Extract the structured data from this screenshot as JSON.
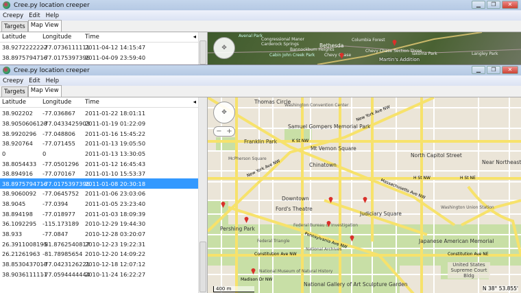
{
  "app_title": "Cree.py location creeper",
  "menu": [
    "Creepy",
    "Edit",
    "Help"
  ],
  "tabs": [
    "Targets",
    "Map View"
  ],
  "window_buttons": {
    "minimize": "▁",
    "restore": "❐",
    "close": "✕"
  },
  "columns": [
    "Latitude",
    "Longitude",
    "Time"
  ],
  "top_window": {
    "rows": [
      [
        "38.9272222222",
        "-77.0736111111",
        "2011-04-12 14:15:47"
      ],
      [
        "38.8975794716",
        "-77.0175397396",
        "2011-04-09 23:59:40"
      ]
    ],
    "map_labels": [
      "Avenal Park",
      "Congressional Manor",
      "Carderock Springs",
      "Cabin John Creek Park",
      "Bannockburn Heights",
      "Bethesda",
      "Columbia Forest",
      "Chevy Chase",
      "Chevy Chase Section Three",
      "Takoma Park",
      "Langley Park",
      "Martin's Addition"
    ]
  },
  "bottom_window": {
    "rows": [
      [
        "38.902202",
        "-77.036867",
        "2011-01-22 18:01:11"
      ],
      [
        "38.9050606128",
        "-77.0433425903",
        "2011-01-19 01:22:09"
      ],
      [
        "38.9920296",
        "-77.048806",
        "2011-01-16 15:45:22"
      ],
      [
        "38.920764",
        "-77.071455",
        "2011-01-13 19:05:50"
      ],
      [
        "0",
        "0",
        "2011-01-13 13:30:05"
      ],
      [
        "38.8054433",
        "-77.0501296",
        "2011-01-12 16:45:43"
      ],
      [
        "38.894916",
        "-77.070167",
        "2011-01-10 15:53:37"
      ],
      [
        "38.8975794716",
        "-77.0175397396",
        "2011-01-08 20:30:18"
      ],
      [
        "38.9060092",
        "-77.0645752",
        "2011-01-06 23:03:06"
      ],
      [
        "38.9045",
        "-77.0394",
        "2011-01-05 23:23:40"
      ],
      [
        "38.894198",
        "-77.018977",
        "2011-01-03 18:09:39"
      ],
      [
        "36.1092295",
        "-115.173189",
        "2010-12-29 19:44:30"
      ],
      [
        "38.933",
        "-77.0847",
        "2010-12-28 03:20:07"
      ],
      [
        "26.3911008195",
        "-81.8762540817",
        "2010-12-23 19:22:31"
      ],
      [
        "26.21261963",
        "-81.78985654",
        "2010-12-20 14:09:22"
      ],
      [
        "38.8530437018",
        "-77.0423126221",
        "2010-12-18 12:07:12"
      ],
      [
        "38.9036111111",
        "-77.0594444444",
        "2010-11-24 16:22:27"
      ]
    ],
    "selected_index": 7,
    "map_labels": {
      "thomas_circle": "Thomas Circle",
      "convention": "Washington Convention Center",
      "gompers": "Samuel Gompers Memorial Park",
      "franklin": "Franklin Park",
      "mcpherson": "McPherson Square",
      "mtvernon": "Mt Vernon Square",
      "chinatown": "Chinatown",
      "downtown": "Downtown",
      "fords": "Ford's Theatre",
      "judiciary": "Judiciary Square",
      "ncapitol": "North Capitol Street",
      "near_ne": "Near Northeast",
      "union": "Washington Union Station",
      "pershing": "Pershing Park",
      "fbi": "Federal Bureau of Investigation",
      "triangle": "Federal Triangle",
      "archives": "National Archives",
      "nmnh": "National Museum of Natural History",
      "ngart": "National Gallery of Art Sculpture Garden",
      "japanese": "Japanese American Memorial",
      "supreme": "United States Supreme Court Bldg",
      "k_st": "K St NW",
      "ny_ave": "New York Ave NW",
      "mass_ave": "Massachusetts Ave NW",
      "penn_ave": "Pennsylvania Ave NW",
      "const_nw": "Constitution Ave NW",
      "const_ne": "Constitution Ave NE",
      "h_st": "H St NW",
      "h_st_ne": "H St NE",
      "madison": "Madison Dr NW"
    },
    "scale": "400 m",
    "coordinate": "N 38° 53.855'"
  },
  "colors": {
    "selected": "#3399ff",
    "road": "#f7e26b",
    "park": "#c8dfa6",
    "land": "#ebe5d8",
    "marker": "#d9302a"
  }
}
